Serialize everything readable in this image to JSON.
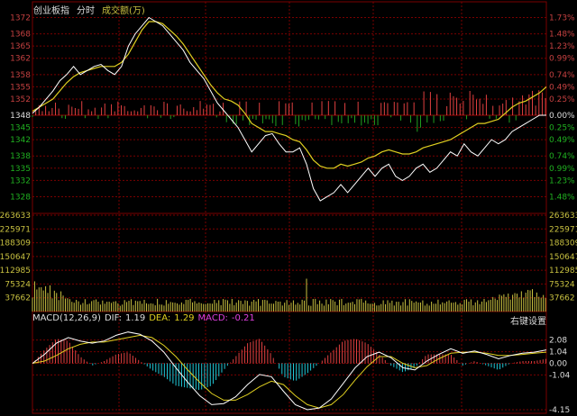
{
  "header": {
    "index_name": "创业板指",
    "mode": "分时",
    "volume_label": "成交额(万)"
  },
  "macd_header": {
    "name": "MACD(12,26,9)",
    "dif_label": "DIF:",
    "dif_value": "1.19",
    "dea_label": "DEA:",
    "dea_value": "1.29",
    "macd_label": "MACD:",
    "macd_value": "-0.21",
    "settings_button": "右键设置"
  },
  "colors": {
    "background": "#000000",
    "grid": "#7a0000",
    "price_label": "#c44040",
    "price_line": "#ffffff",
    "avg_line": "#e0d020",
    "up_bar": "#e04040",
    "down_bar": "#20a020",
    "volume_bar": "#c8c040",
    "volume_label": "#c8c040",
    "macd_pos": "#e04040",
    "macd_neg": "#20c8d8",
    "dif_line": "#ffffff",
    "dea_line": "#e0d020",
    "macd_text": "#e040e0"
  },
  "chart_data": [
    {
      "type": "line",
      "name": "price",
      "base_price": 1348,
      "y_ticks": [
        1372,
        1368,
        1365,
        1362,
        1358,
        1355,
        1352,
        1348,
        1345,
        1342,
        1338,
        1335,
        1332,
        1328
      ],
      "pct_ticks": [
        "1.73%",
        "1.48%",
        "1.23%",
        "0.99%",
        "0.74%",
        "0.49%",
        "0.25%",
        "0.00%",
        "0.25%",
        "0.49%",
        "0.74%",
        "0.99%",
        "1.23%",
        "1.48%"
      ],
      "ylim": [
        1325,
        1373
      ],
      "price": [
        [
          0,
          1348.5
        ],
        [
          5,
          1350
        ],
        [
          10,
          1352
        ],
        [
          15,
          1354
        ],
        [
          20,
          1356.5
        ],
        [
          25,
          1358
        ],
        [
          30,
          1360
        ],
        [
          35,
          1358
        ],
        [
          40,
          1359
        ],
        [
          45,
          1360
        ],
        [
          50,
          1360.5
        ],
        [
          55,
          1359
        ],
        [
          60,
          1358
        ],
        [
          65,
          1360
        ],
        [
          70,
          1365
        ],
        [
          75,
          1368
        ],
        [
          80,
          1370
        ],
        [
          85,
          1372
        ],
        [
          90,
          1371
        ],
        [
          95,
          1370
        ],
        [
          100,
          1368
        ],
        [
          105,
          1366
        ],
        [
          110,
          1364
        ],
        [
          115,
          1361
        ],
        [
          120,
          1359
        ],
        [
          125,
          1357
        ],
        [
          130,
          1354
        ],
        [
          135,
          1351
        ],
        [
          140,
          1349
        ],
        [
          145,
          1347
        ],
        [
          150,
          1345
        ],
        [
          155,
          1342
        ],
        [
          160,
          1339
        ],
        [
          165,
          1341
        ],
        [
          170,
          1343
        ],
        [
          175,
          1343.5
        ],
        [
          180,
          1341
        ],
        [
          185,
          1339
        ],
        [
          190,
          1339
        ],
        [
          195,
          1340
        ],
        [
          200,
          1336
        ],
        [
          205,
          1330
        ],
        [
          210,
          1327
        ],
        [
          215,
          1328
        ],
        [
          220,
          1329
        ],
        [
          225,
          1331
        ],
        [
          230,
          1329
        ],
        [
          235,
          1331
        ],
        [
          240,
          1333
        ],
        [
          245,
          1335
        ],
        [
          250,
          1333
        ],
        [
          255,
          1335
        ],
        [
          260,
          1336
        ],
        [
          265,
          1333
        ],
        [
          270,
          1332
        ],
        [
          275,
          1333
        ],
        [
          280,
          1335
        ],
        [
          285,
          1336
        ],
        [
          290,
          1334
        ],
        [
          295,
          1335
        ],
        [
          300,
          1337
        ],
        [
          305,
          1339
        ],
        [
          310,
          1338
        ],
        [
          315,
          1341
        ],
        [
          320,
          1339
        ],
        [
          325,
          1338
        ],
        [
          330,
          1340
        ],
        [
          335,
          1342
        ],
        [
          340,
          1341
        ],
        [
          345,
          1342
        ],
        [
          350,
          1344
        ],
        [
          355,
          1345
        ],
        [
          360,
          1346
        ],
        [
          365,
          1347
        ],
        [
          370,
          1348
        ],
        [
          375,
          1348
        ]
      ],
      "avg": [
        [
          0,
          1349
        ],
        [
          5,
          1350
        ],
        [
          10,
          1351
        ],
        [
          15,
          1352
        ],
        [
          20,
          1354
        ],
        [
          25,
          1356
        ],
        [
          30,
          1357.5
        ],
        [
          35,
          1358.5
        ],
        [
          40,
          1359
        ],
        [
          45,
          1359.5
        ],
        [
          50,
          1360
        ],
        [
          55,
          1360
        ],
        [
          60,
          1360
        ],
        [
          65,
          1361
        ],
        [
          70,
          1363
        ],
        [
          75,
          1366
        ],
        [
          80,
          1369
        ],
        [
          85,
          1371
        ],
        [
          90,
          1371
        ],
        [
          95,
          1370.5
        ],
        [
          100,
          1369
        ],
        [
          105,
          1367.5
        ],
        [
          110,
          1365.5
        ],
        [
          115,
          1363
        ],
        [
          120,
          1360.5
        ],
        [
          125,
          1358
        ],
        [
          130,
          1355.5
        ],
        [
          135,
          1353.5
        ],
        [
          140,
          1352
        ],
        [
          145,
          1351.5
        ],
        [
          150,
          1350.5
        ],
        [
          155,
          1348.5
        ],
        [
          160,
          1346
        ],
        [
          165,
          1345
        ],
        [
          170,
          1344
        ],
        [
          175,
          1344
        ],
        [
          180,
          1343.5
        ],
        [
          185,
          1343
        ],
        [
          190,
          1342
        ],
        [
          195,
          1341.5
        ],
        [
          200,
          1339.5
        ],
        [
          205,
          1337
        ],
        [
          210,
          1335.5
        ],
        [
          215,
          1335
        ],
        [
          220,
          1335
        ],
        [
          225,
          1336
        ],
        [
          230,
          1335.5
        ],
        [
          235,
          1336
        ],
        [
          240,
          1336.5
        ],
        [
          245,
          1337.5
        ],
        [
          250,
          1338
        ],
        [
          255,
          1339
        ],
        [
          260,
          1339.5
        ],
        [
          265,
          1339
        ],
        [
          270,
          1338.5
        ],
        [
          275,
          1338.5
        ],
        [
          280,
          1339
        ],
        [
          285,
          1340
        ],
        [
          290,
          1340.5
        ],
        [
          295,
          1341
        ],
        [
          300,
          1341.5
        ],
        [
          305,
          1342
        ],
        [
          310,
          1343
        ],
        [
          315,
          1344
        ],
        [
          320,
          1345
        ],
        [
          325,
          1346
        ],
        [
          330,
          1346
        ],
        [
          335,
          1346.5
        ],
        [
          340,
          1347
        ],
        [
          345,
          1348.5
        ],
        [
          350,
          1350
        ],
        [
          355,
          1351
        ],
        [
          360,
          1351.5
        ],
        [
          365,
          1352.5
        ],
        [
          370,
          1353.5
        ],
        [
          375,
          1355
        ]
      ]
    },
    {
      "type": "bar",
      "name": "volume",
      "y_ticks": [
        "263633",
        "225971",
        "188309",
        "150647",
        "112985",
        "75324",
        "37662"
      ],
      "ylim": [
        0,
        263633
      ]
    },
    {
      "type": "bar",
      "name": "macd",
      "y_ticks": [
        "2.08",
        "1.04",
        "0.00",
        "-1.04",
        "-4.15"
      ],
      "ylim": [
        -4.15,
        3.1
      ],
      "dif": [
        [
          0,
          0
        ],
        [
          10,
          0.8
        ],
        [
          20,
          1.8
        ],
        [
          30,
          2.3
        ],
        [
          40,
          2.0
        ],
        [
          50,
          1.8
        ],
        [
          60,
          2.0
        ],
        [
          70,
          2.5
        ],
        [
          80,
          2.8
        ],
        [
          90,
          2.6
        ],
        [
          100,
          2.0
        ],
        [
          110,
          1.0
        ],
        [
          120,
          -0.4
        ],
        [
          130,
          -1.7
        ],
        [
          140,
          -2.9
        ],
        [
          150,
          -3.7
        ],
        [
          160,
          -3.6
        ],
        [
          170,
          -3.0
        ],
        [
          180,
          -1.9
        ],
        [
          190,
          -1.0
        ],
        [
          200,
          -1.2
        ],
        [
          210,
          -2.5
        ],
        [
          220,
          -3.7
        ],
        [
          230,
          -4.15
        ],
        [
          240,
          -4.0
        ],
        [
          250,
          -3.2
        ],
        [
          260,
          -1.8
        ],
        [
          270,
          -0.4
        ],
        [
          280,
          0.6
        ],
        [
          290,
          1.0
        ],
        [
          300,
          0.5
        ],
        [
          310,
          -0.4
        ],
        [
          320,
          -0.6
        ],
        [
          330,
          0.2
        ],
        [
          340,
          0.8
        ],
        [
          350,
          1.3
        ],
        [
          360,
          0.9
        ],
        [
          370,
          1.1
        ],
        [
          380,
          0.8
        ],
        [
          390,
          0.4
        ],
        [
          400,
          0.7
        ],
        [
          410,
          0.9
        ],
        [
          420,
          1.0
        ],
        [
          430,
          1.2
        ]
      ],
      "dea": [
        [
          0,
          0
        ],
        [
          10,
          0.2
        ],
        [
          20,
          0.7
        ],
        [
          30,
          1.3
        ],
        [
          40,
          1.7
        ],
        [
          50,
          1.9
        ],
        [
          60,
          1.9
        ],
        [
          70,
          2.1
        ],
        [
          80,
          2.3
        ],
        [
          90,
          2.5
        ],
        [
          100,
          2.3
        ],
        [
          110,
          1.6
        ],
        [
          120,
          0.6
        ],
        [
          130,
          -0.6
        ],
        [
          140,
          -1.7
        ],
        [
          150,
          -2.7
        ],
        [
          160,
          -3.3
        ],
        [
          170,
          -3.3
        ],
        [
          180,
          -2.8
        ],
        [
          190,
          -2.1
        ],
        [
          200,
          -1.6
        ],
        [
          210,
          -1.9
        ],
        [
          220,
          -2.9
        ],
        [
          230,
          -3.7
        ],
        [
          240,
          -4.0
        ],
        [
          250,
          -3.7
        ],
        [
          260,
          -2.8
        ],
        [
          270,
          -1.5
        ],
        [
          280,
          -0.3
        ],
        [
          290,
          0.6
        ],
        [
          300,
          0.6
        ],
        [
          310,
          0.0
        ],
        [
          320,
          -0.4
        ],
        [
          330,
          -0.2
        ],
        [
          340,
          0.4
        ],
        [
          350,
          0.9
        ],
        [
          360,
          1.0
        ],
        [
          370,
          1.0
        ],
        [
          380,
          0.9
        ],
        [
          390,
          0.7
        ],
        [
          400,
          0.7
        ],
        [
          410,
          0.8
        ],
        [
          420,
          0.9
        ],
        [
          430,
          1.0
        ]
      ]
    }
  ]
}
